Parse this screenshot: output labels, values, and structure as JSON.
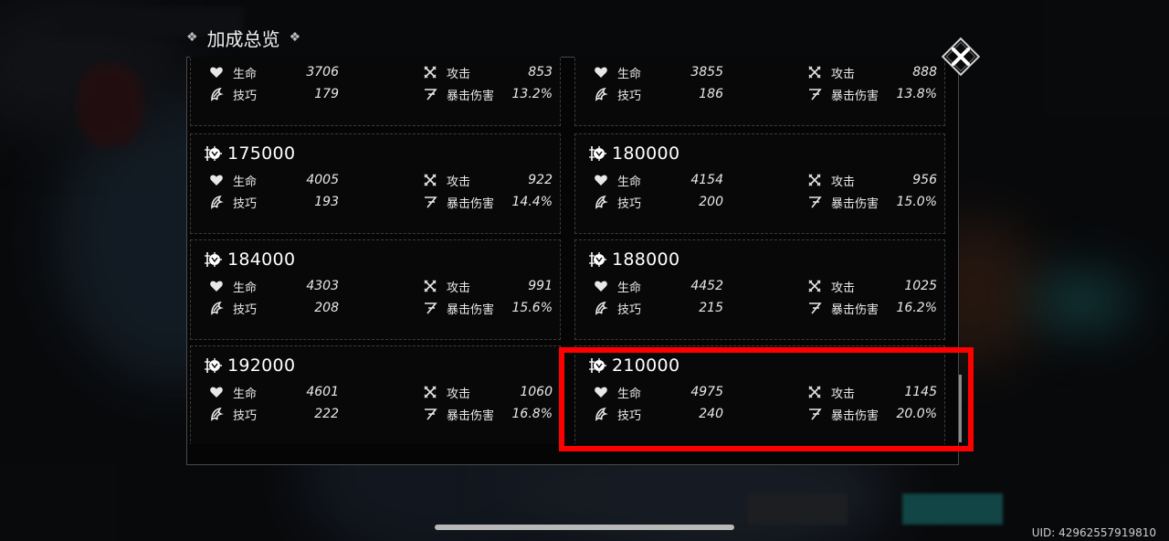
{
  "modal": {
    "title": "加成总览",
    "close_icon": "close-x-icon"
  },
  "labels": {
    "hp": "生命",
    "skill": "技巧",
    "attack": "攻击",
    "crit_damage": "暴击伤害"
  },
  "icons": {
    "hp": "heart-icon",
    "skill": "skill-icon",
    "attack": "crossed-swords-icon",
    "crit_damage": "crit-slash-icon",
    "card": "power-emblem-icon"
  },
  "cards": [
    {
      "value": "",
      "hp": "3706",
      "skill": "179",
      "attack": "853",
      "crit_damage": "13.2%"
    },
    {
      "value": "",
      "hp": "3855",
      "skill": "186",
      "attack": "888",
      "crit_damage": "13.8%"
    },
    {
      "value": "175000",
      "hp": "4005",
      "skill": "193",
      "attack": "922",
      "crit_damage": "14.4%"
    },
    {
      "value": "180000",
      "hp": "4154",
      "skill": "200",
      "attack": "956",
      "crit_damage": "15.0%"
    },
    {
      "value": "184000",
      "hp": "4303",
      "skill": "208",
      "attack": "991",
      "crit_damage": "15.6%"
    },
    {
      "value": "188000",
      "hp": "4452",
      "skill": "215",
      "attack": "1025",
      "crit_damage": "16.2%"
    },
    {
      "value": "192000",
      "hp": "4601",
      "skill": "222",
      "attack": "1060",
      "crit_damage": "16.8%"
    },
    {
      "value": "210000",
      "hp": "4975",
      "skill": "240",
      "attack": "1145",
      "crit_damage": "20.0%"
    }
  ],
  "footer": {
    "uid": "UID: 42962557919810"
  },
  "colors": {
    "highlight": "#ff0000",
    "panel_bg": "#050505",
    "text": "#e8e8e8"
  }
}
